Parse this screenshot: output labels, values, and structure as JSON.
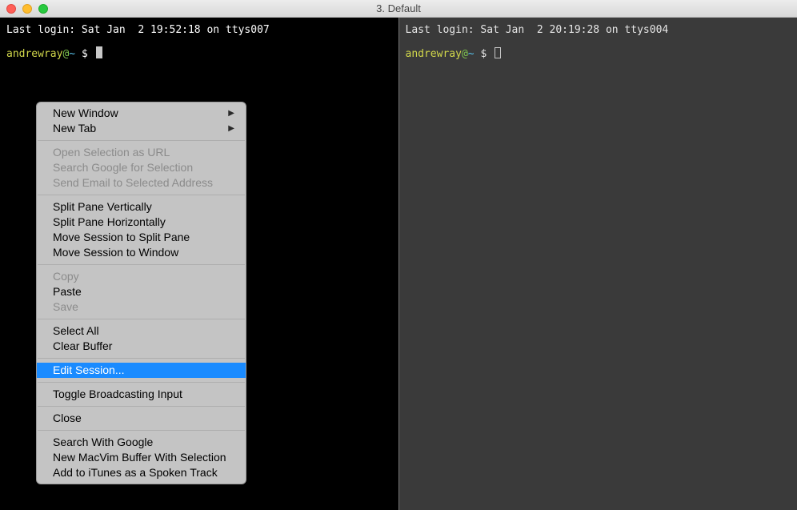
{
  "window": {
    "title": "3. Default"
  },
  "left_pane": {
    "login_line": "Last login: Sat Jan  2 19:52:18 on ttys007",
    "prompt": {
      "user": "andrewray",
      "at": "@",
      "tilde": "~",
      "dollar": "$"
    }
  },
  "right_pane": {
    "login_line": "Last login: Sat Jan  2 20:19:28 on ttys004",
    "prompt": {
      "user": "andrewray",
      "at": "@",
      "tilde": "~",
      "dollar": "$"
    }
  },
  "context_menu": {
    "groups": [
      [
        {
          "label": "New Window",
          "submenu": true,
          "disabled": false
        },
        {
          "label": "New Tab",
          "submenu": true,
          "disabled": false
        }
      ],
      [
        {
          "label": "Open Selection as URL",
          "disabled": true
        },
        {
          "label": "Search Google for Selection",
          "disabled": true
        },
        {
          "label": "Send Email to Selected Address",
          "disabled": true
        }
      ],
      [
        {
          "label": "Split Pane Vertically",
          "disabled": false
        },
        {
          "label": "Split Pane Horizontally",
          "disabled": false
        },
        {
          "label": "Move Session to Split Pane",
          "disabled": false
        },
        {
          "label": "Move Session to Window",
          "disabled": false
        }
      ],
      [
        {
          "label": "Copy",
          "disabled": true
        },
        {
          "label": "Paste",
          "disabled": false
        },
        {
          "label": "Save",
          "disabled": true
        }
      ],
      [
        {
          "label": "Select All",
          "disabled": false
        },
        {
          "label": "Clear Buffer",
          "disabled": false
        }
      ],
      [
        {
          "label": "Edit Session...",
          "disabled": false,
          "highlight": true
        }
      ],
      [
        {
          "label": "Toggle Broadcasting Input",
          "disabled": false
        }
      ],
      [
        {
          "label": "Close",
          "disabled": false
        }
      ],
      [
        {
          "label": "Search With Google",
          "disabled": false
        },
        {
          "label": "New MacVim Buffer With Selection",
          "disabled": false
        },
        {
          "label": "Add to iTunes as a Spoken Track",
          "disabled": false
        }
      ]
    ]
  }
}
